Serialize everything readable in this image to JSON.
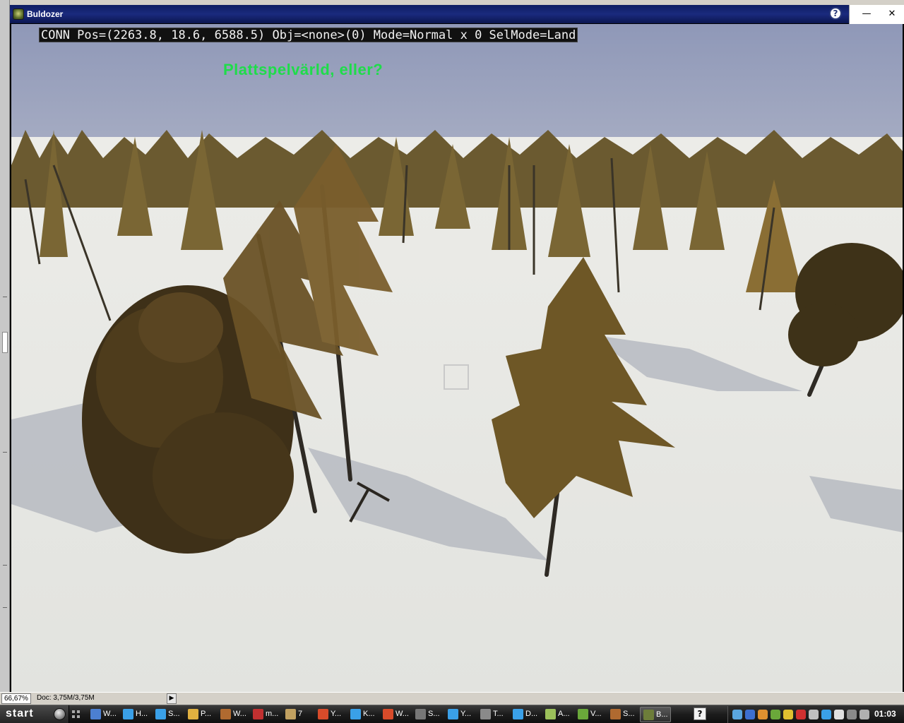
{
  "window": {
    "title": "Buldozer",
    "help_glyph": "?",
    "minimize_glyph": "—",
    "close_glyph": "✕"
  },
  "hud": {
    "status_line": "CONN Pos=(2263.8, 18.6, 6588.5) Obj=<none>(0) Mode=Normal x 0 SelMode=Land",
    "message": "Plattspelvärld, eller?"
  },
  "scene": {
    "sky_color": "#9aa2bd",
    "snow_color": "#e6e7e3"
  },
  "background_app": {
    "zoom": "66,67%",
    "doc_info": "Doc: 3,75M/3,75M",
    "arrow_glyph": "▶"
  },
  "taskbar": {
    "start_label": "start",
    "items": [
      {
        "label": "W...",
        "icon": "paint-icon",
        "color": "#4c7fd1"
      },
      {
        "label": "H...",
        "icon": "messenger-icon",
        "color": "#3aa0e8"
      },
      {
        "label": "S...",
        "icon": "messenger-icon",
        "color": "#3aa0e8"
      },
      {
        "label": "P...",
        "icon": "folder-icon",
        "color": "#e0b040"
      },
      {
        "label": "W...",
        "icon": "archive-icon",
        "color": "#b06a30"
      },
      {
        "label": "m...",
        "icon": "app-icon",
        "color": "#c03030"
      },
      {
        "label": "7",
        "icon": "pencil-icon",
        "color": "#c0a060"
      },
      {
        "label": "Y...",
        "icon": "browser-icon",
        "color": "#d84b2a"
      },
      {
        "label": "K...",
        "icon": "messenger-icon",
        "color": "#3aa0e8"
      },
      {
        "label": "W...",
        "icon": "browser-icon",
        "color": "#d84b2a"
      },
      {
        "label": "S...",
        "icon": "steam-icon",
        "color": "#777777"
      },
      {
        "label": "Y...",
        "icon": "messenger-icon",
        "color": "#3aa0e8"
      },
      {
        "label": "T...",
        "icon": "text-icon",
        "color": "#8a8a8a"
      },
      {
        "label": "D...",
        "icon": "messenger-icon",
        "color": "#3aa0e8"
      },
      {
        "label": "A...",
        "icon": "pencil-icon",
        "color": "#9bc05a"
      },
      {
        "label": "V...",
        "icon": "check-icon",
        "color": "#6aa83a"
      },
      {
        "label": "S...",
        "icon": "archive-icon",
        "color": "#b06a30"
      },
      {
        "label": "B...",
        "icon": "buldozer-icon",
        "color": "#6d7d3a",
        "active": true
      }
    ],
    "help_glyph": "?",
    "clock": "01:03"
  }
}
